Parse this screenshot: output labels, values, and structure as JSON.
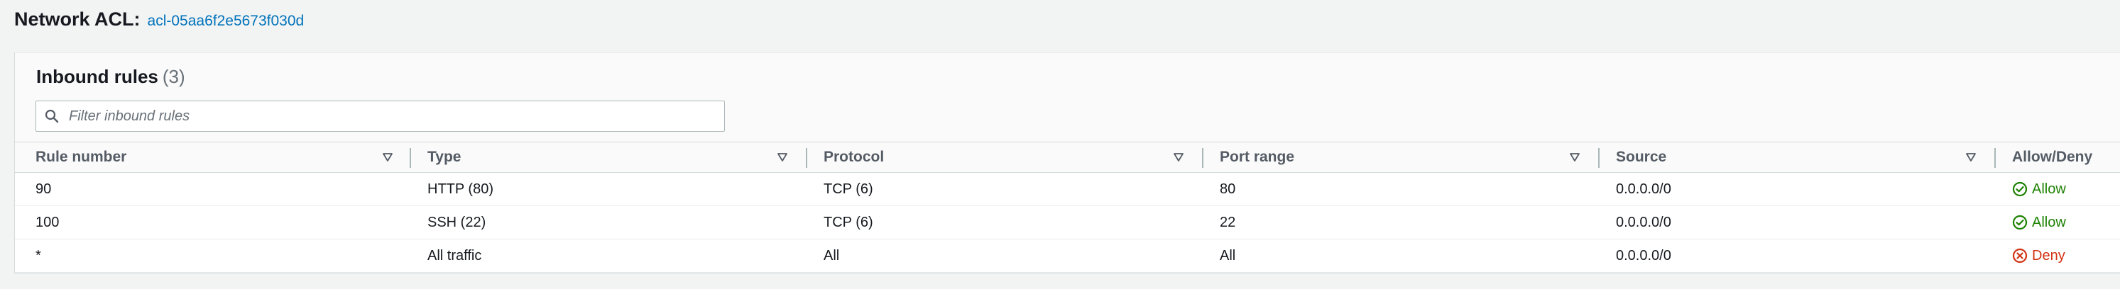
{
  "header": {
    "label": "Network ACL:",
    "acl_id": "acl-05aa6f2e5673f030d"
  },
  "panel": {
    "title": "Inbound rules",
    "count": "(3)",
    "filter_placeholder": "Filter inbound rules"
  },
  "table": {
    "columns": [
      "Rule number",
      "Type",
      "Protocol",
      "Port range",
      "Source",
      "Allow/Deny"
    ],
    "rows": [
      {
        "rule_number": "90",
        "type": "HTTP (80)",
        "protocol": "TCP (6)",
        "port_range": "80",
        "source": "0.0.0.0/0",
        "action": "Allow"
      },
      {
        "rule_number": "100",
        "type": "SSH (22)",
        "protocol": "TCP (6)",
        "port_range": "22",
        "source": "0.0.0.0/0",
        "action": "Allow"
      },
      {
        "rule_number": "*",
        "type": "All traffic",
        "protocol": "All",
        "port_range": "All",
        "source": "0.0.0.0/0",
        "action": "Deny"
      }
    ]
  },
  "colors": {
    "allow": "#1d8102",
    "deny": "#d13212",
    "link": "#0073bb"
  },
  "icons": {
    "filter": "search-icon",
    "sort": "sort-down-triangle-icon",
    "allow": "check-circle-icon",
    "deny": "x-circle-icon"
  }
}
